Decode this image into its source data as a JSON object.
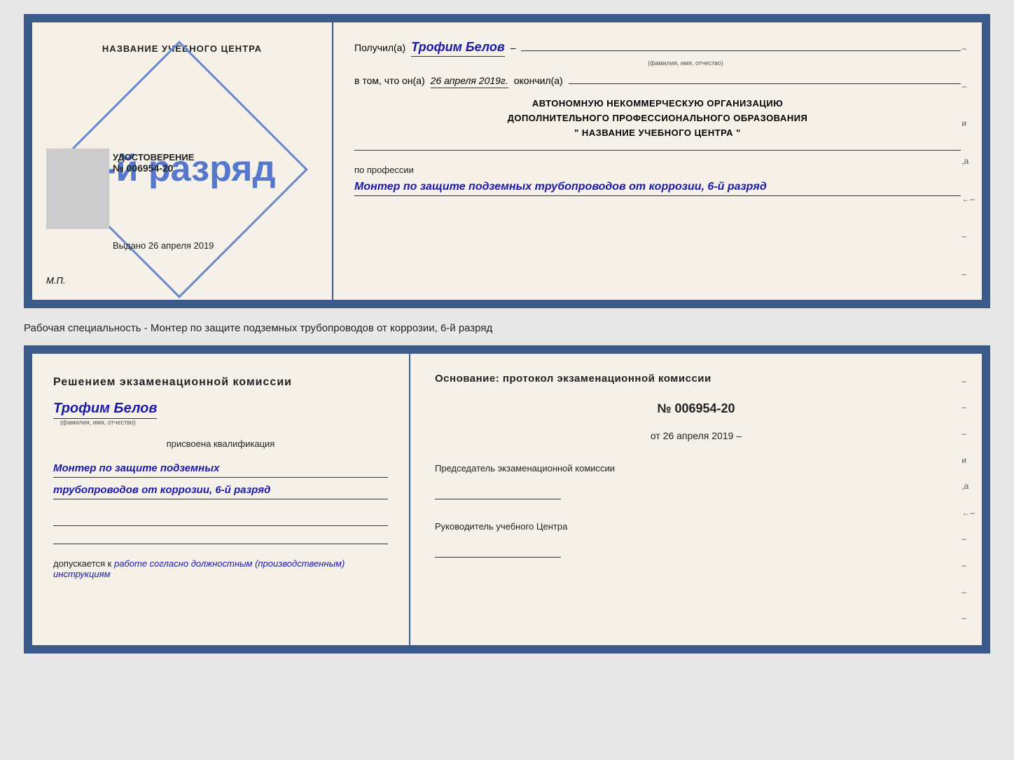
{
  "page": {
    "background": "#e8e8e8"
  },
  "top_cert": {
    "left": {
      "title": "НАЗВАНИЕ УЧЕБНОГО ЦЕНТРА",
      "stamp_text": "6-й разряд",
      "udost_label": "УДОСТОВЕРЕНИЕ",
      "udost_number": "№ 006954-20",
      "vydano_label": "Выдано",
      "vydano_date": "26 апреля 2019",
      "mp": "М.П."
    },
    "right": {
      "received_label": "Получил(а)",
      "received_name": "Трофим Белов",
      "fio_hint": "(фамилия, имя, отчество)",
      "in_that_label": "в том, что он(а)",
      "date_value": "26 апреля 2019г.",
      "finished_label": "окончил(а)",
      "org_line1": "АВТОНОМНУЮ НЕКОММЕРЧЕСКУЮ ОРГАНИЗАЦИЮ",
      "org_line2": "ДОПОЛНИТЕЛЬНОГО ПРОФЕССИОНАЛЬНОГО ОБРАЗОВАНИЯ",
      "org_line3": "\"  НАЗВАНИЕ УЧЕБНОГО ЦЕНТРА  \"",
      "profession_label": "по профессии",
      "profession_value": "Монтер по защите подземных трубопроводов от коррозии, 6-й разряд"
    }
  },
  "middle": {
    "text": "Рабочая специальность - Монтер по защите подземных трубопроводов от коррозии, 6-й разряд"
  },
  "bottom_cert": {
    "left": {
      "commission_title": "Решением экзаменационной комиссии",
      "person_name": "Трофим Белов",
      "fio_hint": "(фамилия, имя, отчество)",
      "assigned_label": "присвоена квалификация",
      "profession_line1": "Монтер по защите подземных",
      "profession_line2": "трубопроводов от коррозии, 6-й разряд",
      "допускается_label": "допускается к",
      "допускается_value": "работе согласно должностным (производственным) инструкциям"
    },
    "right": {
      "osnov_label": "Основание: протокол экзаменационной комиссии",
      "protocol_number": "№ 006954-20",
      "protocol_date_prefix": "от",
      "protocol_date": "26 апреля 2019",
      "chairman_title": "Председатель экзаменационной комиссии",
      "head_title": "Руководитель учебного Центра"
    }
  }
}
